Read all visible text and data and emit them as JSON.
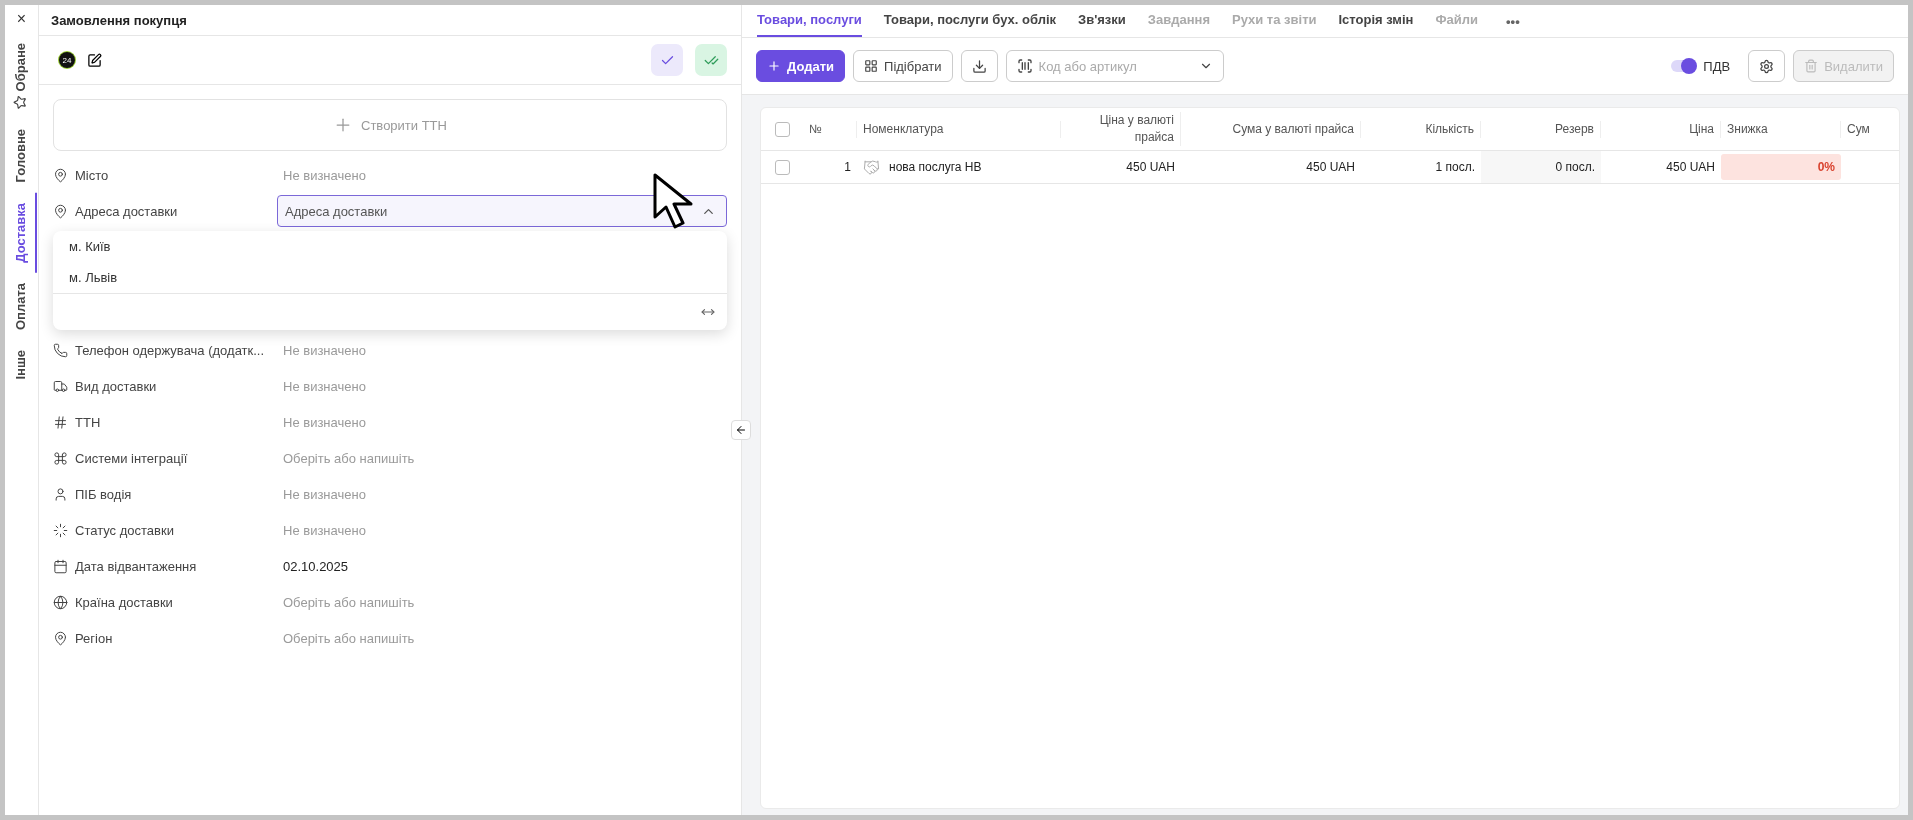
{
  "side_tabs": [
    {
      "label": "Обране",
      "selected": false
    },
    {
      "label": "Головне",
      "selected": false
    },
    {
      "label": "Доставка",
      "selected": true
    },
    {
      "label": "Оплата",
      "selected": false
    },
    {
      "label": "Інше",
      "selected": false
    }
  ],
  "close": "×",
  "title": "Замовлення покупця",
  "badge": "24",
  "create_button": "Створити ТТН",
  "fields_top": [
    {
      "label": "Місто",
      "placeholder": "Не визначено"
    },
    {
      "label": "Адреса доставки",
      "kind": "select",
      "placeholder": "Адреса доставки",
      "open": true
    }
  ],
  "dropdown": {
    "options": [
      "м. Київ",
      "м. Львів"
    ]
  },
  "fields": [
    {
      "label": "Телефон одержувача (додатк...",
      "placeholder": "Не визначено"
    },
    {
      "label": "Вид доставки",
      "placeholder": "Не визначено"
    },
    {
      "label": "ТТН",
      "placeholder": "Не визначено"
    },
    {
      "label": "Системи інтеграції",
      "placeholder": "Оберіть або напишіть"
    },
    {
      "label": "ПІБ водія",
      "placeholder": "Не визначено"
    },
    {
      "label": "Статус доставки",
      "placeholder": "Не визначено"
    },
    {
      "label": "Дата відвантаження",
      "value": "02.10.2025"
    },
    {
      "label": "Країна доставки",
      "placeholder": "Оберіть або напишіть"
    },
    {
      "label": "Регіон",
      "placeholder": "Оберіть або напишіть"
    }
  ],
  "tabs": [
    {
      "label": "Товари, послуги",
      "selected": true,
      "disabled": false
    },
    {
      "label": "Товари, послуги бух. облік",
      "selected": false,
      "disabled": false
    },
    {
      "label": "Зв'язки",
      "selected": false,
      "disabled": false
    },
    {
      "label": "Завдання",
      "selected": false,
      "disabled": true
    },
    {
      "label": "Рухи та звіти",
      "selected": false,
      "disabled": true
    },
    {
      "label": "Історія змін",
      "selected": false,
      "disabled": false
    },
    {
      "label": "Файли",
      "selected": false,
      "disabled": true
    }
  ],
  "more": "•••",
  "toolbar": {
    "add": "Додати",
    "pick": "Підібрати",
    "search_placeholder": "Код або артикул",
    "vat": {
      "label": "ПДВ",
      "on": true
    },
    "delete": {
      "label": "Видалити",
      "disabled": true
    }
  },
  "table": {
    "all_checked": false,
    "columns": [
      "№",
      "Номенклатура",
      "Ціна у валюті прайса",
      "Сума у валюті прайса",
      "Кількість",
      "Резерв",
      "Ціна",
      "Знижка",
      "Сум"
    ],
    "rows": [
      {
        "checked": false,
        "number": "1",
        "name": "нова послуга НВ",
        "price": {
          "amount": "450",
          "unit": "UAH"
        },
        "sum": {
          "amount": "450",
          "unit": "UAH"
        },
        "qty": {
          "amount": "1",
          "unit": "посл."
        },
        "reserve": {
          "amount": "0",
          "unit": "посл."
        },
        "net_price": {
          "amount": "450",
          "unit": "UAH"
        },
        "discount": "0%"
      }
    ]
  }
}
